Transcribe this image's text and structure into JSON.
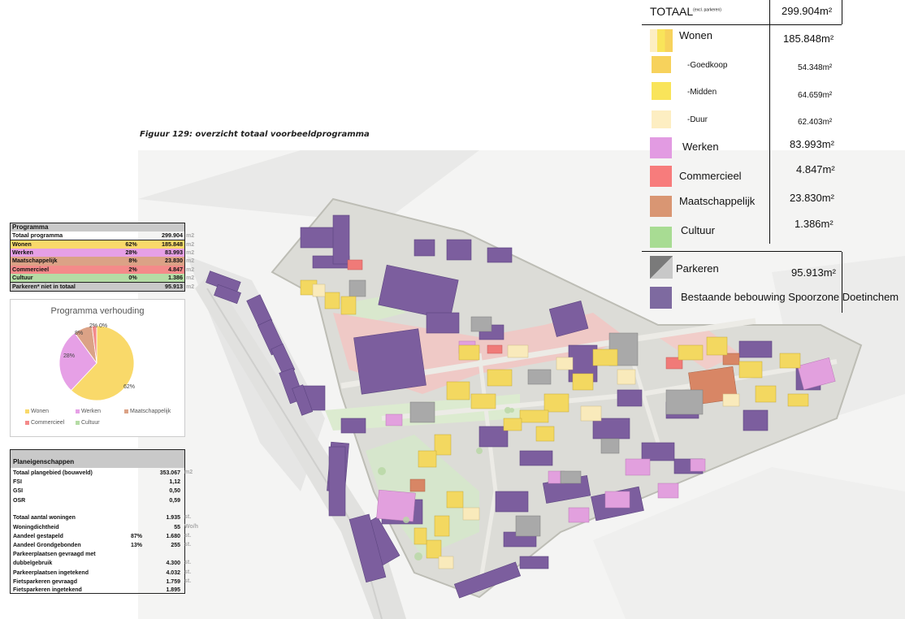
{
  "caption": "Figuur 129: overzicht totaal voorbeeldprogramma",
  "legend": {
    "title": "TOTAAL",
    "title_note": "(excl. parkeren)",
    "total": "299.904m²",
    "items": [
      {
        "label": "Wonen",
        "value": "185.848m²",
        "color": "#f6d66a"
      },
      {
        "label": "-Goedkoop",
        "value": "54.348m²",
        "color": "#f7d25c",
        "sub": true
      },
      {
        "label": "-Midden",
        "value": "64.659m²",
        "color": "#f9e45a",
        "sub": true
      },
      {
        "label": "-Duur",
        "value": "62.403m²",
        "color": "#fdeec2",
        "sub": true
      },
      {
        "label": "Werken",
        "value": "83.993m²",
        "color": "#e29be2"
      },
      {
        "label": "Commercieel",
        "value": "4.847m²",
        "color": "#f77c7c"
      },
      {
        "label": "Maatschappelijk",
        "value": "23.830m²",
        "color": "#d99673"
      },
      {
        "label": "Cultuur",
        "value": "1.386m²",
        "color": "#a8dc93"
      },
      {
        "label": "Parkeren",
        "value": "95.913m²",
        "color": "#8c8c8c"
      },
      {
        "label": "Bestaande bebouwing Spoorzone Doetinchem",
        "value": "",
        "color": "#7e6aa0"
      }
    ]
  },
  "programma": {
    "header": "Programma",
    "total_label": "Totaal programma",
    "total_value": "299.904",
    "unit": "m2",
    "rows": [
      {
        "label": "Wonen",
        "pct": "62%",
        "value": "185.848",
        "color": "#f9d96a"
      },
      {
        "label": "Werken",
        "pct": "28%",
        "value": "83.993",
        "color": "#e6a0e6"
      },
      {
        "label": "Maatschappelijk",
        "pct": "8%",
        "value": "23.830",
        "color": "#dba286"
      },
      {
        "label": "Commercieel",
        "pct": "2%",
        "value": "4.847",
        "color": "#f48a8a"
      },
      {
        "label": "Cultuur",
        "pct": "0%",
        "value": "1.386",
        "color": "#b5dca5"
      }
    ],
    "parkeren_label": "Parkeren* niet in totaal",
    "parkeren_value": "95.913"
  },
  "chart_data": {
    "type": "pie",
    "title": "Programma verhouding",
    "categories": [
      "Wonen",
      "Werken",
      "Maatschappelijk",
      "Commercieel",
      "Cultuur"
    ],
    "values": [
      62,
      28,
      8,
      2,
      0
    ],
    "data_labels": [
      "62%",
      "28%",
      "8%",
      "2%",
      "0%"
    ],
    "colors": [
      "#f9d96a",
      "#e6a0e6",
      "#dba286",
      "#f48a8a",
      "#b5dca5"
    ],
    "legend_position": "bottom"
  },
  "planeigenschappen": {
    "header": "Planeigenschappen",
    "rows": [
      {
        "label": "Totaal plangebied (bouwveld)",
        "pct": "",
        "value": "353.067",
        "unit": "m2"
      },
      {
        "label": "FSI",
        "pct": "",
        "value": "1,12",
        "unit": ""
      },
      {
        "label": "GSI",
        "pct": "",
        "value": "0,50",
        "unit": ""
      },
      {
        "label": "OSR",
        "pct": "",
        "value": "0,59",
        "unit": ""
      },
      {
        "label": "Totaal aantal woningen",
        "pct": "",
        "value": "1.935",
        "unit": "st."
      },
      {
        "label": "Woningdichtheid",
        "pct": "",
        "value": "55",
        "unit": "Wo/h"
      },
      {
        "label": "Aandeel gestapeld",
        "pct": "87%",
        "value": "1.680",
        "unit": "st."
      },
      {
        "label": "Aandeel Grondgebonden",
        "pct": "13%",
        "value": "255",
        "unit": "st."
      },
      {
        "label": "Parkeerplaatsen gevraagd met",
        "pct": "",
        "value": "",
        "unit": ""
      },
      {
        "label": "dubbelgebruik",
        "pct": "",
        "value": "4.300",
        "unit": "st."
      },
      {
        "label": "Parkeerplaatsen ingetekend",
        "pct": "",
        "value": "4.032",
        "unit": "st."
      },
      {
        "label": "Fietsparkeren gevraagd",
        "pct": "",
        "value": "1.759",
        "unit": "st."
      },
      {
        "label": "Fietsparkeren ingetekend",
        "pct": "",
        "value": "1.895",
        "unit": ""
      }
    ]
  }
}
